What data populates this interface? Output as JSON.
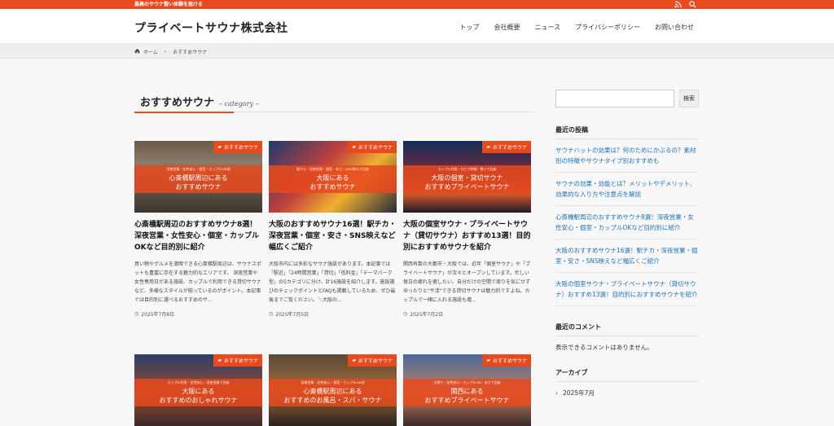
{
  "topbar": {
    "tagline": "最高のサウナ整い体験を届ける",
    "rss_icon": "rss-icon",
    "search_icon": "search-icon"
  },
  "header": {
    "site_title": "プライベートサウナ株式会社",
    "nav": [
      "トップ",
      "会社概要",
      "ニュース",
      "プライバシーポリシー",
      "お問い合わせ"
    ]
  },
  "breadcrumb": {
    "home": "ホーム",
    "current": "おすすめサウナ"
  },
  "page": {
    "title": "おすすめサウナ",
    "subtitle": "– category –"
  },
  "colors": {
    "accent": "#e8491d",
    "link": "#1e73be"
  },
  "posts": [
    {
      "category": "おすすめサウナ",
      "thumb_small": "深夜営業・女性安心・個室・カップルOK他",
      "thumb_l1": "心斎橋駅周辺にある",
      "thumb_l2": "おすすめサウナ",
      "title": "心斎橋駅周辺のおすすめサウナ8選！深夜営業・女性安心・個室・カップルOKなど目的別に紹介",
      "excerpt": "買い物やグルメを満喫できる心斎橋駅周辺は、サウナスポットも豊富に存在する魅力的なエリアです。 深夜営業や女性専用日がある施設、カップルで利用できる貸切サウナなど、多様なスタイルが揃っているのがポイント。本記事では目的別に選べるおすすめのサ…",
      "date": "2025年7月8日"
    },
    {
      "category": "おすすめサウナ",
      "thumb_small": "駅チカ・深夜営業・個室・安さ・SNS映えで比較",
      "thumb_l1": "大阪にある",
      "thumb_l2": "おすすめサウナ",
      "title": "大阪のおすすめサウナ16選！駅チカ・深夜営業・個室・安さ・SNS映えなど幅広くご紹介",
      "excerpt": "大阪市内には多彩なサウナ施設があります。本記事では「駅近」「24時間営業」「貸切」「低料金」「テーマパーク型」の5カテゴリに分け、計16施設を紹介します。施設選びのチェックポイントとFAQも掲載しているため、ぜひ最後までご覧ください。＼大阪の…",
      "date": "2025年7月5日"
    },
    {
      "category": "おすすめサウナ",
      "thumb_small": "カップル利用・ひとり時間・整いで比較",
      "thumb_l1": "大阪の個室・貸切サウナ",
      "thumb_l2": "おすすめプライベートサウナ",
      "title": "大阪の個室サウナ・プライベートサウナ（貸切サウナ）おすすめ13選！目的別におすすめサウナを紹介",
      "excerpt": "関西有数の大都市・大阪では、近年「個室サウナ」や「プライベートサウナ」が次々とオープンしています。忙しい毎日の疲れを癒したい、自分だけの空間で周りを気にせずゆったりと\"サ活\"できる貸切サウナは魅力的ですよね。カップルで一緒に入れる施設も増…",
      "date": "2025年7月2日"
    },
    {
      "category": "おすすめサウナ",
      "thumb_small": "カップル利用・女性安心・深夜営業で比較",
      "thumb_l1": "大阪にある",
      "thumb_l2": "おすすめのおしゃれサウナ",
      "title": "",
      "excerpt": "",
      "date": ""
    },
    {
      "category": "おすすめサウナ",
      "thumb_small": "深夜営業・女性安心・個室・カップルOK他",
      "thumb_l1": "心斎橋駅周辺にある",
      "thumb_l2": "おすすめのお風呂・スパ・サウナ",
      "title": "",
      "excerpt": "",
      "date": ""
    },
    {
      "category": "おすすめサウナ",
      "thumb_small": "日帰り・女性安心・カップルOK・安さで比較",
      "thumb_l1": "関西にある",
      "thumb_l2": "おすすめプライベートサウナ",
      "title": "",
      "excerpt": "",
      "date": ""
    }
  ],
  "sidebar": {
    "search_placeholder": "",
    "search_button": "検索",
    "recent_posts_heading": "最近の投稿",
    "recent_posts": [
      "サウナハットの効果は？何のためにかぶるの？素材別の特徴やサウナタイプ別おすすめも",
      "サウナの効果・効能とは？メリットやデメリット、効果的な入り方や注意点を解説",
      "心斎橋駅周辺のおすすめサウナ8選！深夜営業・女性安心・個室・カップルOKなど目的別に紹介",
      "大阪のおすすめサウナ16選！駅チカ・深夜営業・個室・安さ・SNS映えなど幅広くご紹介",
      "大阪の個室サウナ・プライベートサウナ（貸切サウナ）おすすめ13選！目的別におすすめサウナを紹介"
    ],
    "recent_comments_heading": "最近のコメント",
    "no_comments": "表示できるコメントはありません。",
    "archive_heading": "アーカイブ",
    "archive_item": "2025年7月"
  }
}
